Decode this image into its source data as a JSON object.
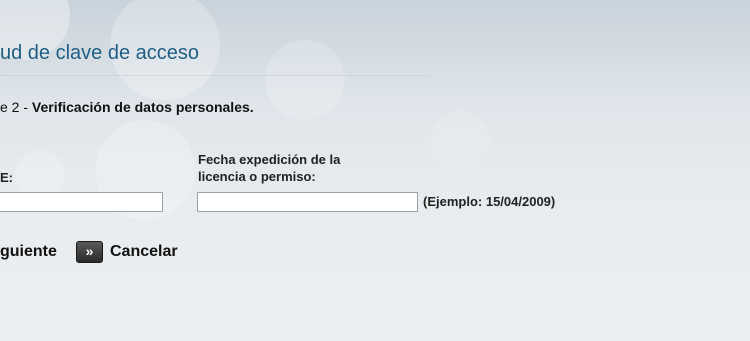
{
  "header": {
    "title": "ud de clave de acceso"
  },
  "step": {
    "prefix": "e 2 - ",
    "text": "Verificación de datos personales."
  },
  "form": {
    "left_label": "E:",
    "left_value": "",
    "right_label": "Fecha expedición de la licencia o permiso:",
    "right_value": "",
    "right_hint": "(Ejemplo: 15/04/2009)"
  },
  "actions": {
    "next_label": "guiente",
    "next_icon": "double-chevron-right-icon",
    "cancel_label": "Cancelar"
  }
}
